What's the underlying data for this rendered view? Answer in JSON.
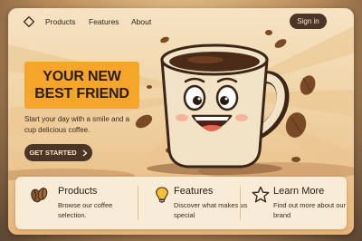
{
  "nav": {
    "links": [
      "Products",
      "Features",
      "About"
    ],
    "signin_label": "Sign in"
  },
  "hero": {
    "headline_line1": "YOUR NEW",
    "headline_line2": "BEST FRIEND",
    "subtitle": "Start your day with a smile and a cup delicious coffee.",
    "cta_label": "GET STARTED",
    "cta_icon": "chevron-right-icon"
  },
  "features": [
    {
      "icon": "coffee-beans-icon",
      "title": "Products",
      "description": "Browse our coffee selection."
    },
    {
      "icon": "lightbulb-icon",
      "title": "Features",
      "description": "Discover what makes us special"
    },
    {
      "icon": "star-icon",
      "title": "Learn More",
      "description": "Find out more about our brand"
    }
  ],
  "colors": {
    "accent": "#f4a52a",
    "dark": "#4a3526",
    "cream": "#f8ecd7"
  }
}
